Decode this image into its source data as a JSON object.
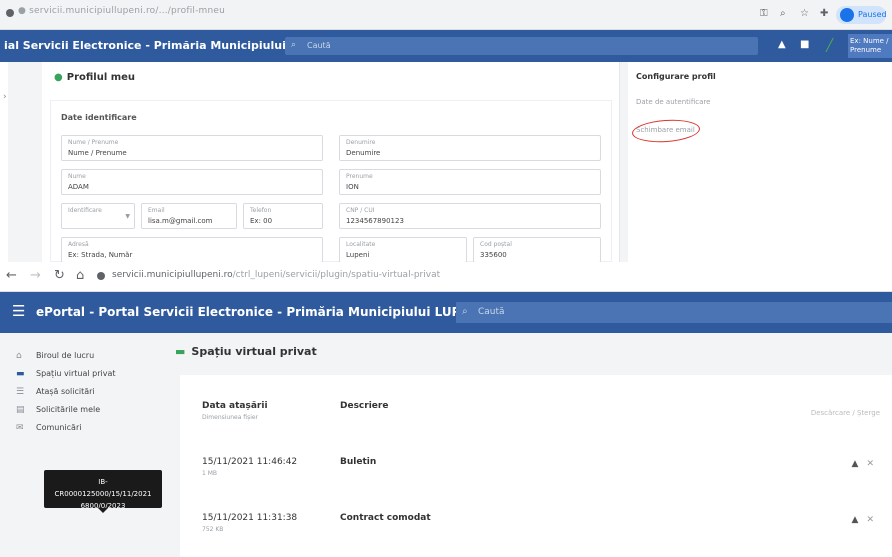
{
  "top_screen": {
    "url": "● servicii.municipiullupeni.ro/…/profil-mneu",
    "profile_pill": "Paused",
    "app_title": "ial Servicii Electronice - Primăria Municipiului LUPENI",
    "search_placeholder": "Caută",
    "user_label": "Ex: Nume / Prenume",
    "profile_title": "Profilul meu",
    "card_title": "Date identificare",
    "fields": [
      {
        "label": "Nume / Prenume",
        "value": "Nume / Prenume"
      },
      {
        "label": "Denumire",
        "value": "Denumire"
      },
      {
        "label": "Nume",
        "value": "ADAM"
      },
      {
        "label": "Prenume",
        "value": "ION"
      },
      {
        "label": "Identificare",
        "value": ""
      },
      {
        "label": "Email",
        "value": "lisa.m@gmail.com"
      },
      {
        "label": "Telefon",
        "value": "Ex: 00"
      },
      {
        "label": "CNP / CUI",
        "value": "1234567890123"
      },
      {
        "label": "Adresă",
        "value": "Ex: Strada, Număr"
      },
      {
        "label": "Localitate",
        "value": "Lupeni"
      },
      {
        "label": "Cod poștal",
        "value": "335600"
      }
    ],
    "config_title": "Configurare profil",
    "config_links": [
      "Date de autentificare",
      "Schimbare email"
    ]
  },
  "bottom_screen": {
    "url_domain": "servicii.municipiullupeni.ro",
    "url_path": "/ctrl_lupeni/servicii/plugin/spatiu-virtual-privat",
    "header_title": "ePortal - Portal Servicii Electronice - Primăria Municipiului LUPENI",
    "search_placeholder": "Caută",
    "sidebar": [
      {
        "label": "Biroul de lucru",
        "icon": "home-icon",
        "glyph": "⌂"
      },
      {
        "label": "Spațiu virtual privat",
        "icon": "folder-icon",
        "glyph": "▬"
      },
      {
        "label": "Atașă solicitări",
        "icon": "document-icon",
        "glyph": "☰"
      },
      {
        "label": "Solicitările mele",
        "icon": "list-icon",
        "glyph": "▤"
      },
      {
        "label": "Comunicări",
        "icon": "message-icon",
        "glyph": "✉"
      }
    ],
    "page_title": "Spațiu virtual privat",
    "table": {
      "col_date": "Data atașării",
      "col_date_sub": "Dimensiunea fișier",
      "col_desc": "Descriere",
      "col_actions": "Descărcare / Șterge",
      "rows": [
        {
          "date": "15/11/2021 11:46:42",
          "size": "1 MB",
          "description": "Buletin",
          "download_icon": "▲",
          "delete_icon": "✕"
        },
        {
          "date": "15/11/2021 11:31:38",
          "size": "752 KB",
          "description": "Contract comodat",
          "download_icon": "▲",
          "delete_icon": "✕"
        }
      ]
    },
    "tooltip_lines": [
      "IB-CR0000125000/15/11/2021",
      "6800/0/2023"
    ]
  }
}
